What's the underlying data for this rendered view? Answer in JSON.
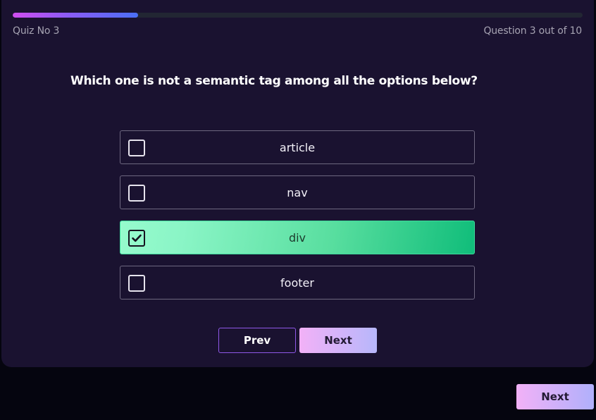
{
  "progress": {
    "fraction": 0.22,
    "quiz_label": "Quiz No 3",
    "counter_label": "Question 3 out of 10"
  },
  "question": "Which one is not a semantic tag among all the options below?",
  "options": [
    {
      "label": "article",
      "checked": false
    },
    {
      "label": "nav",
      "checked": false
    },
    {
      "label": "div",
      "checked": true
    },
    {
      "label": "footer",
      "checked": false
    }
  ],
  "buttons": {
    "prev_label": "Prev",
    "next_label": "Next",
    "outer_next_label": "Next"
  },
  "colors": {
    "page_bg": "#05050f",
    "card_bg": "#1a1230",
    "selected_option": "#10bd7a",
    "progress_start": "#d04ef0",
    "progress_end": "#4a6ff5",
    "button_gradient_start": "#f2b1f7",
    "button_gradient_end": "#b7b7fb"
  }
}
